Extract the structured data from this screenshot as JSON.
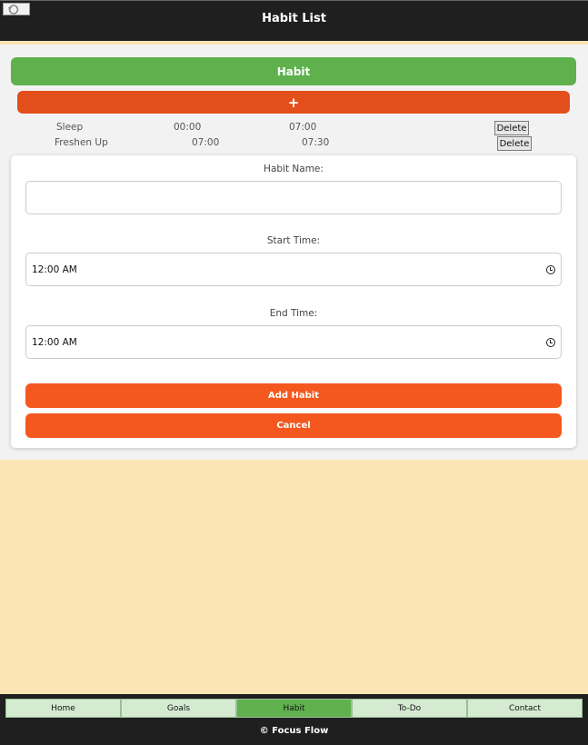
{
  "header": {
    "title": "Habit List",
    "back_icon": "undo-arrow-icon"
  },
  "section": {
    "title": "Habit",
    "add_label": "+"
  },
  "habits": [
    {
      "name": "Sleep",
      "start": "00:00",
      "end": "07:00",
      "delete_label": "Delete"
    },
    {
      "name": "Freshen Up",
      "start": "07:00",
      "end": "07:30",
      "delete_label": "Delete"
    }
  ],
  "form": {
    "name_label": "Habit Name:",
    "name_value": "",
    "start_label": "Start Time:",
    "start_value": "12:00 AM",
    "end_label": "End Time:",
    "end_value": "12:00 AM",
    "add_button": "Add Habit",
    "cancel_button": "Cancel"
  },
  "nav": {
    "items": [
      "Home",
      "Goals",
      "Habit",
      "To-Do",
      "Contact"
    ],
    "active": "Habit"
  },
  "footer": {
    "copyright": "© Focus Flow"
  },
  "colors": {
    "header": "#1f1f1f",
    "green": "#5fb14e",
    "orange": "#f4581f",
    "background": "#fbe5b4"
  }
}
